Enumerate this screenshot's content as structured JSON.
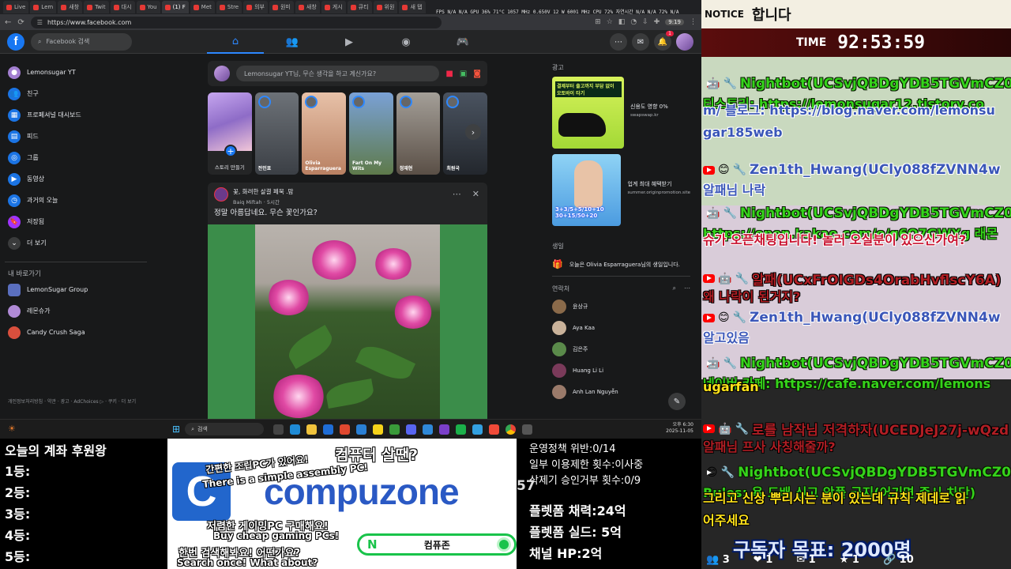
{
  "browser": {
    "tabs": [
      "Live",
      "Lem",
      "새창",
      "Twit",
      "대시",
      "You",
      "(1) F",
      "Met",
      "Stre",
      "의부",
      "원미",
      "새창",
      "게시",
      "큐티",
      "위원",
      "새 탭"
    ],
    "active_tab_index": 6,
    "perf_readout": "FPS N/A N/A GPU 36% 71°C 1057 MHz 0.650V 12 W 6001 MHz CPU 72% 자연시간 N/A N/A 72% N/A",
    "url": "https://www.facebook.com",
    "zoom": "9:19"
  },
  "facebook": {
    "search_placeholder": "Facebook 검색",
    "notif_count": "1",
    "left_menu": [
      {
        "label": "Lemonsugar YT",
        "color": "#a37fd1"
      },
      {
        "label": "친구",
        "color": "#1b74e4"
      },
      {
        "label": "프로페셔널 대시보드",
        "color": "#1b74e4"
      },
      {
        "label": "피드",
        "color": "#1b74e4"
      },
      {
        "label": "그룹",
        "color": "#1b74e4"
      },
      {
        "label": "동영상",
        "color": "#1b74e4"
      },
      {
        "label": "과거의 오늘",
        "color": "#1b74e4"
      },
      {
        "label": "저장됨",
        "color": "#a033ff"
      },
      {
        "label": "더 보기",
        "color": "#3a3b3c"
      }
    ],
    "shortcuts_title": "내 바로가기",
    "shortcuts": [
      {
        "label": "LemonSugar Group"
      },
      {
        "label": "레몬슈가"
      },
      {
        "label": "Candy Crush Saga"
      }
    ],
    "footer": "개인정보처리방침 · 약관 · 광고 · AdChoices ▷ · 쿠키 · 더 보기",
    "composer_placeholder": "Lemonsugar YT님, 무슨 생각을 하고 계신가요?",
    "create_story": "스토리 만들기",
    "stories": [
      {
        "name": "전인표"
      },
      {
        "name": "Olivia Esparraguera"
      },
      {
        "name": "Fart On My Wits"
      },
      {
        "name": "정재현"
      },
      {
        "name": "최원국"
      }
    ],
    "post": {
      "group": "꽃, 화려한 살결 페북 .맘",
      "author": "Baiq Miftah",
      "time": "5시간",
      "text": "정말 아름답네요. 무슨 꽃인가요?"
    },
    "ads_title": "광고",
    "ads": [
      {
        "title": "신용도 영향 0%",
        "source": "swapswap.kr",
        "caption": "결제부터 출고까지 부담 없이 오토바이 타기"
      },
      {
        "title": "업계 최대 혜택받기",
        "source": "summer.originpromotion.site",
        "caption": "3+3/5+5/10+10 30+15/50+20"
      }
    ],
    "birthday_title": "생일",
    "birthday_text": "오늘은 Olivia Esparraguera님의 생일입니다.",
    "contacts_title": "연락처",
    "contacts": [
      {
        "name": "윤상규"
      },
      {
        "name": "Aya Kaa"
      },
      {
        "name": "김은주"
      },
      {
        "name": "Huang Li Li"
      },
      {
        "name": "Anh Lan Nguyễn"
      }
    ]
  },
  "taskbar": {
    "search": "검색",
    "time": "오후 6:30",
    "date": "2025-11-05"
  },
  "chat": {
    "notice_label": "NOTICE",
    "notice_text": "합니다",
    "timer_label": "TIME",
    "timer_value": "92:53:59",
    "messages": [
      {
        "user": "Nightbot(UCSvjQBDgYDB5TGVmCZ0",
        "body": "티스토리: https://lemonsugar12.tistory.co"
      },
      {
        "user": "",
        "body": "m/ 블로그: https://blog.naver.com/lemonsu"
      },
      {
        "user": "",
        "body": "gar185web"
      },
      {
        "user": "Zen1th_Hwang(UCly088fZVNN4w",
        "body": "알패님 나락"
      },
      {
        "user": "Nightbot(UCSvjQBDgYDB5TGVmCZ0",
        "body": "https://open.kakao.com/o/g6O7GWXg 래몬"
      },
      {
        "user": "",
        "body": "슈가 오픈채팅입니다! 놀러 오실분이 있으신가여?"
      },
      {
        "user": "알패(UCxFrOIGDs4OrabHvflscY6A)",
        "body": "왜 나락이 된거지?"
      },
      {
        "user": "Zen1th_Hwang(UCly088fZVNN4w",
        "body": "알고있음"
      },
      {
        "user": "Nightbot(UCSvjQBDgYDB5TGVmCZ0",
        "body": "네이버 카페: https://cafe.naver.com/lemons"
      },
      {
        "user": "",
        "body": "ugarfan"
      },
      {
        "user": "로를 남작님 저격하자(UCEDJeJ27j-wQzd",
        "body": "알패님 프사 사칭해줄까?"
      },
      {
        "user": "Nightbot(UCSvjQBDgYDB5TGVmCZ0",
        "body": "Rules: 욕 도배 신고 악플 금지(어기면 즉시 차단)"
      },
      {
        "user": "",
        "body": "그리고 신상 뿌리시는 분이 있는데 규칙 제데로 읽"
      },
      {
        "user": "",
        "body": "어주세요"
      }
    ],
    "goal": "구독자 목표: 2000명",
    "stats": [
      "3",
      "1",
      "1",
      "1",
      "10"
    ]
  },
  "donor": {
    "title": "오늘의 계좌 후원왕",
    "ranks": [
      "1등:",
      "2등:",
      "3등:",
      "4등:",
      "5등:"
    ]
  },
  "banner": {
    "word": "compuzone",
    "logo": "C",
    "q": "컴퓨터 살땐?",
    "ko1": "간편한 조립PC가 있어요!",
    "en1": "There is a simple assembly PC!",
    "ko2": "저렴한 게이밍PC 구매해요!",
    "en2": "Buy cheap gaming PCs!",
    "ko3": "한번 검색해봐요! 어떤가요?",
    "en3": "Search once! What about?",
    "search_text": "컴퓨존"
  },
  "policy": {
    "lines_small": [
      "운영정책 위반:0/14",
      "일부 이용제한 횟수:이사중",
      "삭제기 승인거부 횟수:0/9"
    ],
    "lines_large": [
      "플렛폼 채력:24억",
      "플렛폼 실드: 5억",
      "채널 HP:2억"
    ],
    "num": "57"
  }
}
